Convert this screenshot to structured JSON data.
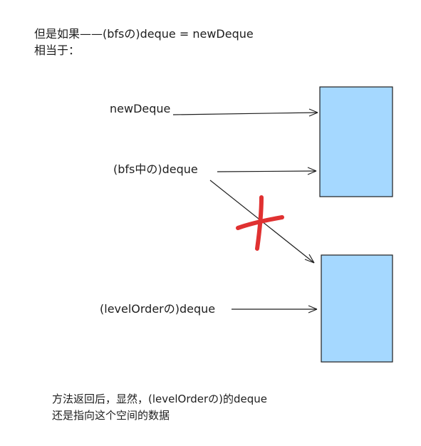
{
  "header": {
    "line1": "但是如果——(bfsの)deque = newDeque",
    "line2": "相当于："
  },
  "labels": {
    "new_deque": "newDeque",
    "bfs_deque": "(bfs中の)deque",
    "levelorder_deque": "(levelOrderの)deque"
  },
  "footer": {
    "line1": "方法返回后，显然，(levelOrderの)的deque",
    "line2": "还是指向这个空间的数据"
  },
  "colors": {
    "box_fill": "#a5d8ff",
    "stroke": "#1e1e1e",
    "cross": "#e03131",
    "background": "#ffffff"
  }
}
